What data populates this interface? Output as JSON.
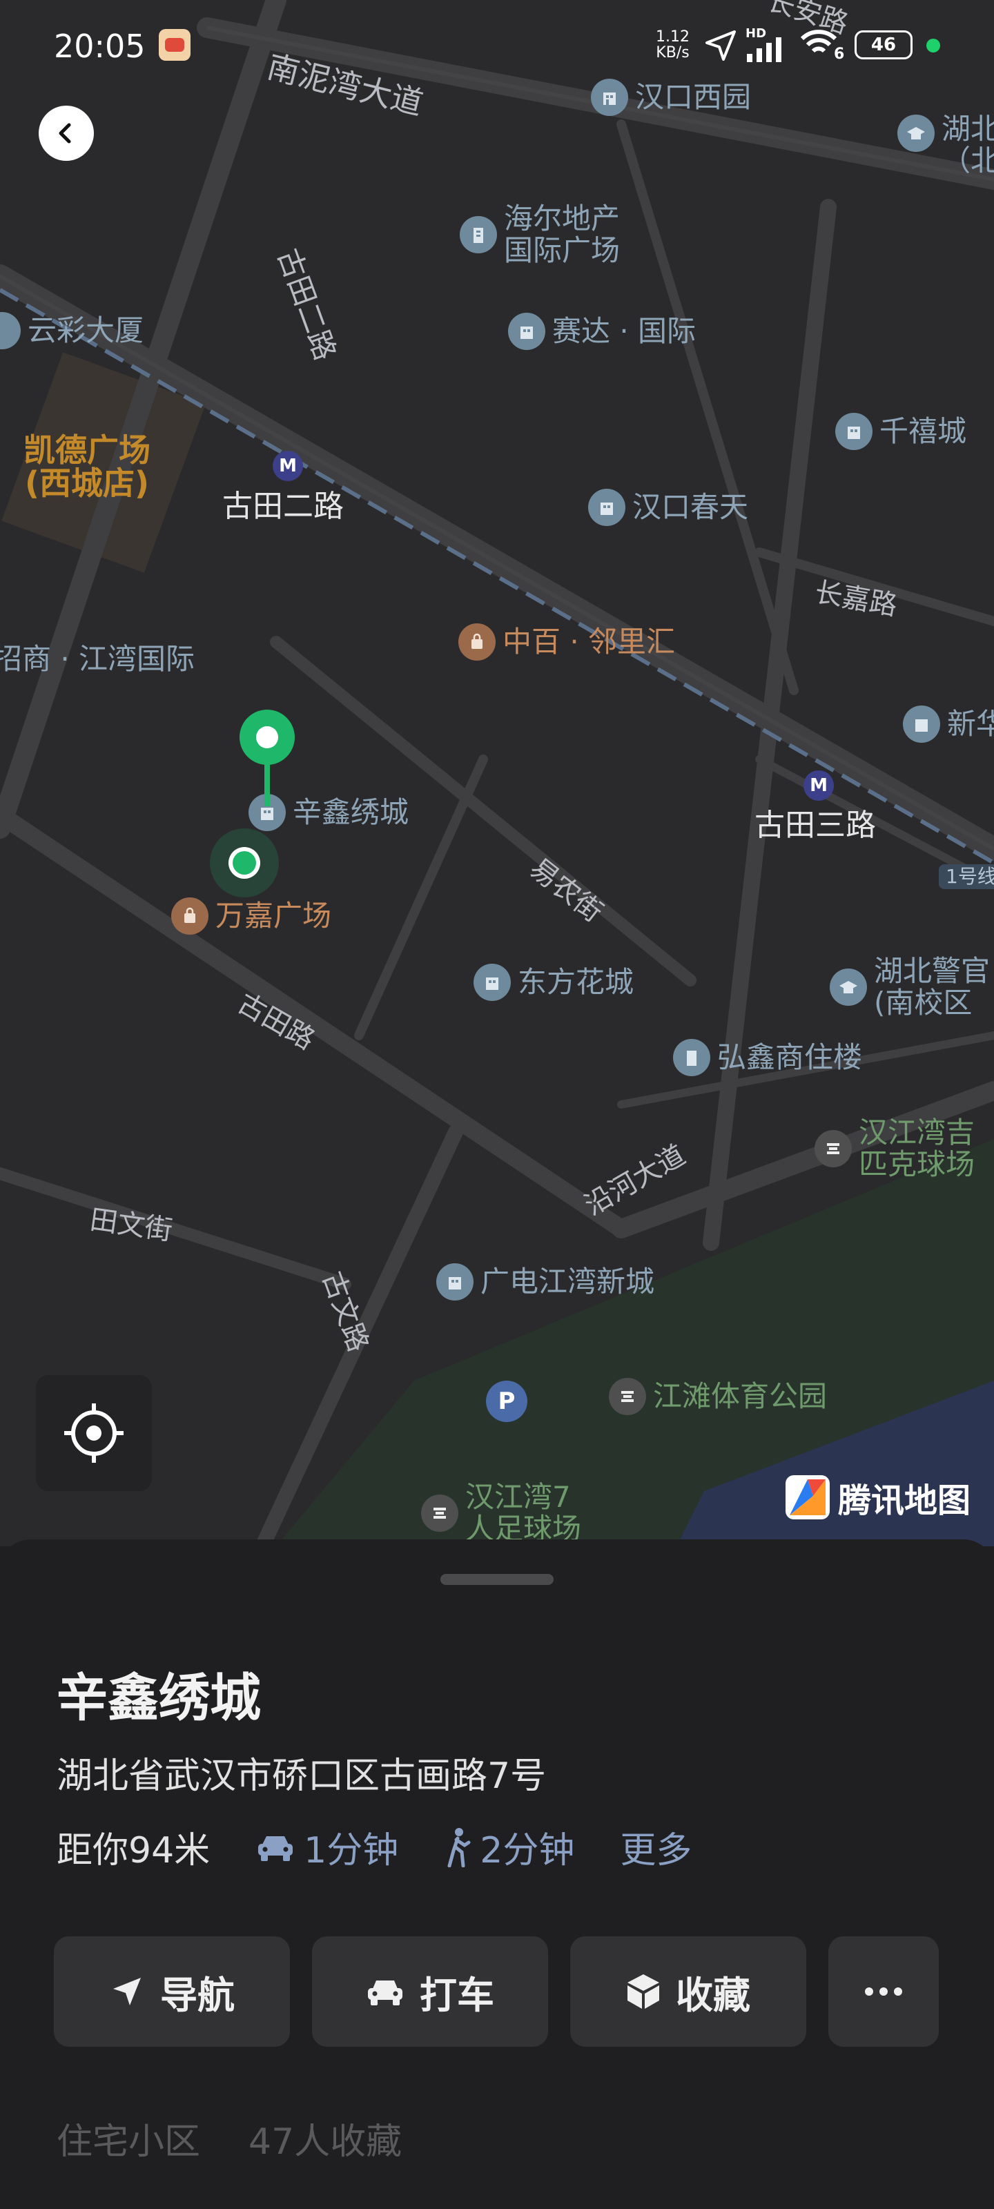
{
  "status_bar": {
    "time": "20:05",
    "net_speed_value": "1.12",
    "net_speed_unit": "KB/s",
    "network_type": "HD",
    "wifi_badge": "6",
    "battery": "46"
  },
  "map": {
    "roads": {
      "nanniwan": "南泥湾大道",
      "gutian_er_lu_v": "古田二路",
      "gutian_er_lu_station": "古田二路",
      "gutian_san_lu_station": "古田三路",
      "changjia_lu": "长嘉路",
      "yinong_jie": "易农街",
      "gutian_lu": "古田路",
      "tianwen_jie": "田文街",
      "guwen_lu": "古文路",
      "yanhe_dadao": "沿河大道",
      "chang_an_lu": "长安路",
      "line1": "1号线"
    },
    "pois": {
      "hankou_xiyuan": "汉口西园",
      "hubei_bei": "湖北",
      "hubei_bei2": "（北",
      "haier": "海尔地产",
      "haier2": "国际广场",
      "yuncai": "云彩大厦",
      "saida": "赛达 · 国际",
      "qianxi": "千禧城",
      "kaide1": "凯德广场",
      "kaide2": "(西城店)",
      "hankou_chuntian": "汉口春天",
      "zhongbai": "中百 · 邻里汇",
      "zhaoshang": "招商 · 江湾国际",
      "xinxin": "辛鑫绣城",
      "wanjia": "万嘉广场",
      "xinhua": "新华",
      "dongfang": "东方花城",
      "hubei_jingguan": "湖北警官",
      "hubei_jingguan2": "(南校区",
      "hongxin": "弘鑫商住楼",
      "hanjiang_pickleball": "汉江湾吉",
      "hanjiang_pickleball2": "匹克球场",
      "guangdian": "广电江湾新城",
      "jiangtan": "江滩体育公园",
      "hanjiang7": "汉江湾7",
      "hanjiang7b": "人足球场"
    },
    "metro_label": "M",
    "parking_label": "P",
    "brand": "腾讯地图"
  },
  "place": {
    "name": "辛鑫绣城",
    "address": "湖北省武汉市硚口区古画路7号",
    "distance": "距你94米",
    "drive_time": "1分钟",
    "walk_time": "2分钟",
    "more": "更多"
  },
  "actions": {
    "navigate": "导航",
    "taxi": "打车",
    "favorite": "收藏"
  },
  "tags": {
    "category": "住宅小区",
    "favorites": "47人收藏"
  },
  "colors": {
    "accent_green": "#1fb86a",
    "link_blue": "#8aa0c4",
    "sheet_bg": "#1f1f21",
    "button_bg": "#323234"
  }
}
